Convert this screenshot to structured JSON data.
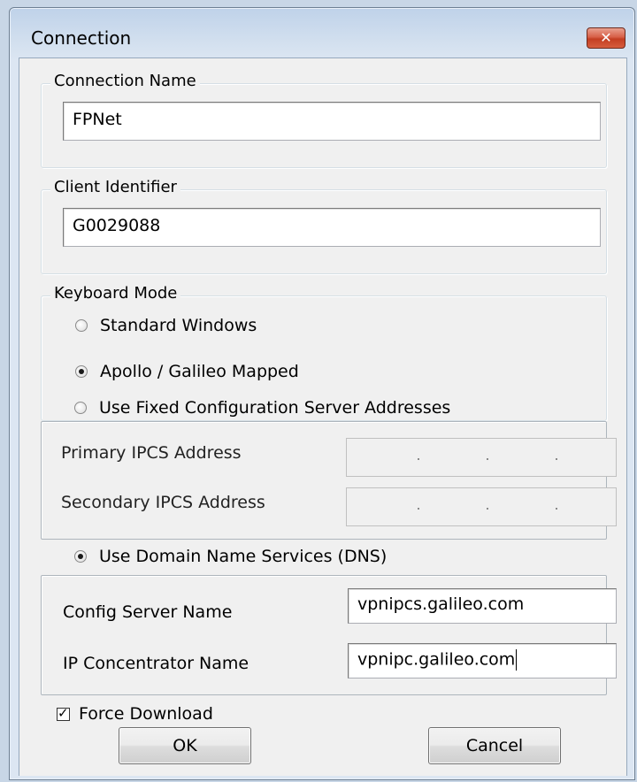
{
  "window": {
    "title": "Connection",
    "close_icon": "close-x-icon"
  },
  "connection_name": {
    "label": "Connection Name",
    "value": "FPNet"
  },
  "client_identifier": {
    "label": "Client Identifier",
    "value": "G0029088"
  },
  "keyboard_mode": {
    "label": "Keyboard Mode",
    "options": [
      {
        "label": "Standard Windows",
        "selected": false
      },
      {
        "label": "Apollo / Galileo Mapped",
        "selected": true
      }
    ]
  },
  "fixed_config": {
    "label": "Use Fixed Configuration Server Addresses",
    "selected": false,
    "primary_label": "Primary IPCS Address",
    "secondary_label": "Secondary IPCS Address"
  },
  "dns": {
    "label": "Use Domain Name Services (DNS)",
    "selected": true,
    "config_server_label": "Config Server Name",
    "config_server_value": "vpnipcs.galileo.com",
    "ip_concentrator_label": "IP Concentrator  Name",
    "ip_concentrator_value": "vpnipc.galileo.com"
  },
  "force_download": {
    "label": "Force Download",
    "checked": true
  },
  "buttons": {
    "ok": "OK",
    "cancel": "Cancel"
  },
  "colors": {
    "close_button": "#c94a31",
    "dialog_background": "#f0f0f0",
    "frame": "#c8d6e6"
  }
}
